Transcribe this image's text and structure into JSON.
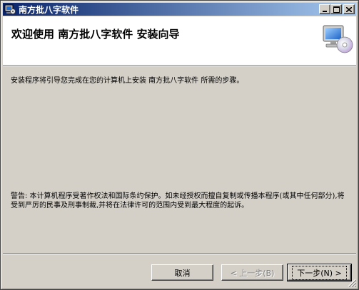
{
  "window": {
    "title": "南方批八字软件"
  },
  "header": {
    "heading": "欢迎使用 南方批八字软件 安装向导"
  },
  "content": {
    "intro": "安装程序将引导您完成在您的计算机上安装 南方批八字软件 所需的步骤。",
    "warning": "警告: 本计算机程序受著作权法和国际条约保护。如未经授权而擅自复制或传播本程序(或其中任何部分),将受到严厉的民事及刑事制裁,并将在法律许可的范围内受到最大程度的起诉。"
  },
  "buttons": {
    "cancel": "取消",
    "back": "< 上一步(B)",
    "next": "下一步(N) >"
  },
  "icons": {
    "app": "installer-icon",
    "header": "computer-cd-icon",
    "minimize": "minimize-icon",
    "maximize": "maximize-icon",
    "close": "close-icon"
  },
  "colors": {
    "titlebar_start": "#0a246a",
    "titlebar_end": "#a6caf0",
    "face": "#d4d0c8",
    "header_bg": "#ffffff"
  }
}
